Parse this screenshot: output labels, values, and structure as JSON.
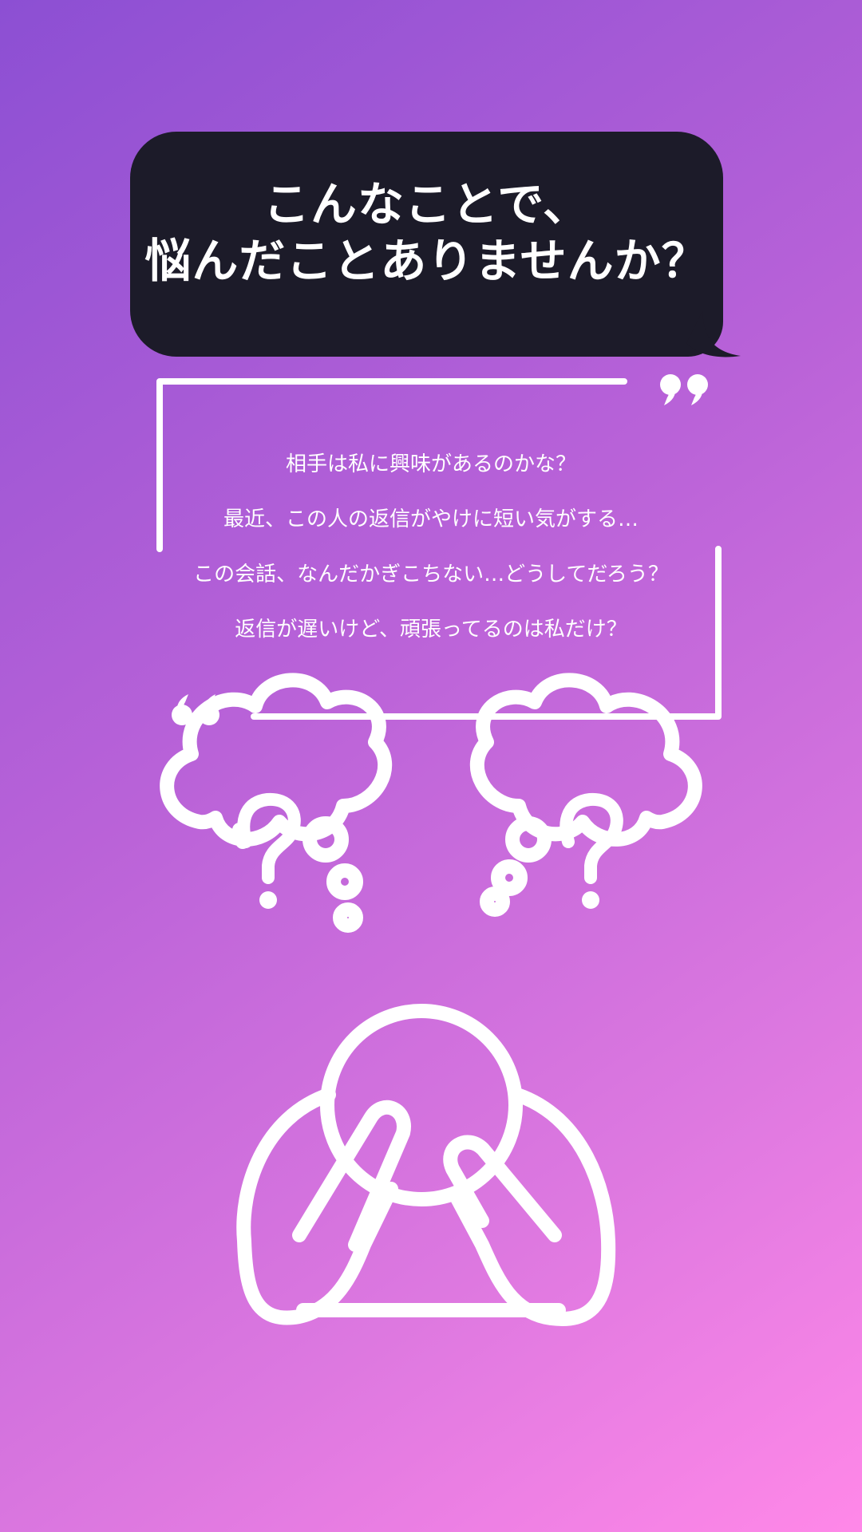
{
  "headline": {
    "line1": "こんなことで、",
    "line2": "悩んだことありませんか？"
  },
  "worries": [
    "相手は私に興味があるのかな？",
    "最近、この人の返信がやけに短い気がする…",
    "この会話、なんだかぎこちない…どうしてだろう？",
    "返信が遅いけど、頑張ってるのは私だけ？"
  ],
  "icons": {
    "close_quote": "closing-quote-icon",
    "open_quote": "opening-quote-icon",
    "thought_left": "question-thought-bubble-icon",
    "thought_right": "question-thought-bubble-icon",
    "person": "worried-person-icon"
  },
  "colors": {
    "gradient_start": "#8c4fd3",
    "gradient_end": "#ff88e8",
    "bubble": "#1c1b29",
    "foreground": "#ffffff"
  }
}
